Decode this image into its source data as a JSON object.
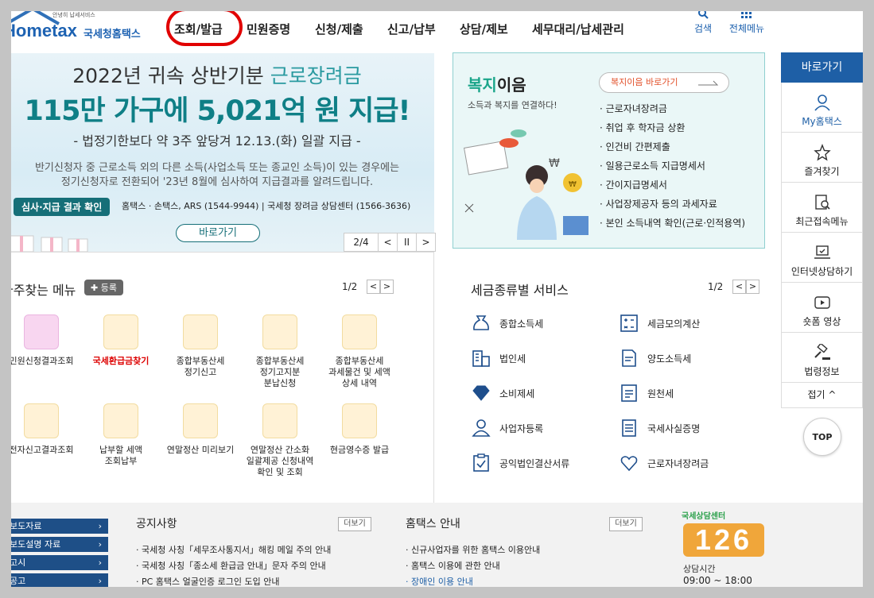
{
  "header": {
    "logo_small": "안녕히 납세서비스",
    "logo_main": "Hometax",
    "logo_kr": "국세청홈택스",
    "nav": [
      "조회/발급",
      "민원증명",
      "신청/제출",
      "신고/납부",
      "상담/제보",
      "세무대리/납세관리"
    ],
    "search_label": "검색",
    "allmenu_label": "전체메뉴"
  },
  "banner": {
    "line1_a": "2022년 귀속 상반기분 ",
    "line1_b": "근로장려금",
    "line2": "115만 가구에 5,021억 원 지급!",
    "line3": "- 법정기한보다 약 3주 앞당겨 12.13.(화) 일괄 지급 -",
    "line4a": "반기신청자 중 근로소득 외의 다른 소득(사업소득 또는 종교인 소득)이 있는 경우에는",
    "line4b": "정기신청자로 전환되어 '23년 8월에 심사하여 지급결과를 알려드립니다.",
    "tag": "심사·지급 결과 확인",
    "tag_text": "홈택스 · 손택스, ARS (1544-9944) | 국세청 장려금 상담센터 (1566-3636)",
    "button": "바로가기",
    "pager": "2/4",
    "prev": "<",
    "pause": "II",
    "next": ">"
  },
  "welfare": {
    "title_a": "복지",
    "title_b": "이음",
    "subtitle": "소득과 복지를 연결하다!",
    "button": "복지이음 바로가기",
    "items": [
      "근로자녀장려금",
      "취업 후 학자금 상환",
      "인건비 간편제출",
      "일용근로소득 지급명세서",
      "간이지급명세서",
      "사업장제공자 등의 과세자료",
      "본인 소득내역 확인(근로·인적용역)"
    ]
  },
  "quick": {
    "title": "바로가기",
    "items": [
      "My홈택스",
      "즐겨찾기",
      "최근접속메뉴",
      "인터넷상담하기",
      "숏폼 영상",
      "법령정보"
    ],
    "collapse": "접기",
    "top": "TOP"
  },
  "freq": {
    "title": "자주찾는 메뉴",
    "register": "등록",
    "page": "1/2",
    "items": [
      [
        "민원신청결과조회"
      ],
      [
        "국세환급금찾기"
      ],
      [
        "종합부동산세",
        "정기신고"
      ],
      [
        "종합부동산세",
        "정기고지분",
        "분납신청"
      ],
      [
        "종합부동산세",
        "과세물건 및 세액",
        "상세 내역"
      ],
      [
        "전자신고결과조회"
      ],
      [
        "납부할 세액",
        "조회납부"
      ],
      [
        "연말정산 미리보기"
      ],
      [
        "연말정산 간소화",
        "일괄제공 신청내역",
        "확인 및 조회"
      ],
      [
        "현금영수증 발급"
      ]
    ]
  },
  "taxsvc": {
    "title": "세금종류별 서비스",
    "page": "1/2",
    "items": [
      "종합소득세",
      "세금모의계산",
      "법인세",
      "양도소득세",
      "소비제세",
      "원천세",
      "사업자등록",
      "국세사실증명",
      "공익법인결산서류",
      "근로자녀장려금"
    ]
  },
  "footer": {
    "buttons": [
      "보도자료",
      "보도설명 자료",
      "고시",
      "공고"
    ],
    "notice_title": "공지사항",
    "notice_more": "더보기",
    "notices": [
      "국세청 사칭「세무조사통지서」해킹 메일 주의 안내",
      "국세청 사칭「종소세 환급금 안내」문자 주의 안내",
      "PC 홈택스 얼굴인증 로그인 도입 안내"
    ],
    "guide_title": "홈택스 안내",
    "guide_more": "더보기",
    "guides": [
      "신규사업자를 위한 홈택스 이용안내",
      "홈택스 이용에 관한 안내",
      "장애인 이용 안내"
    ],
    "center_label": "국세상담센터",
    "center_num": "126",
    "center_hours_label": "상담시간",
    "center_hours": "09:00 ~ 18:00"
  }
}
